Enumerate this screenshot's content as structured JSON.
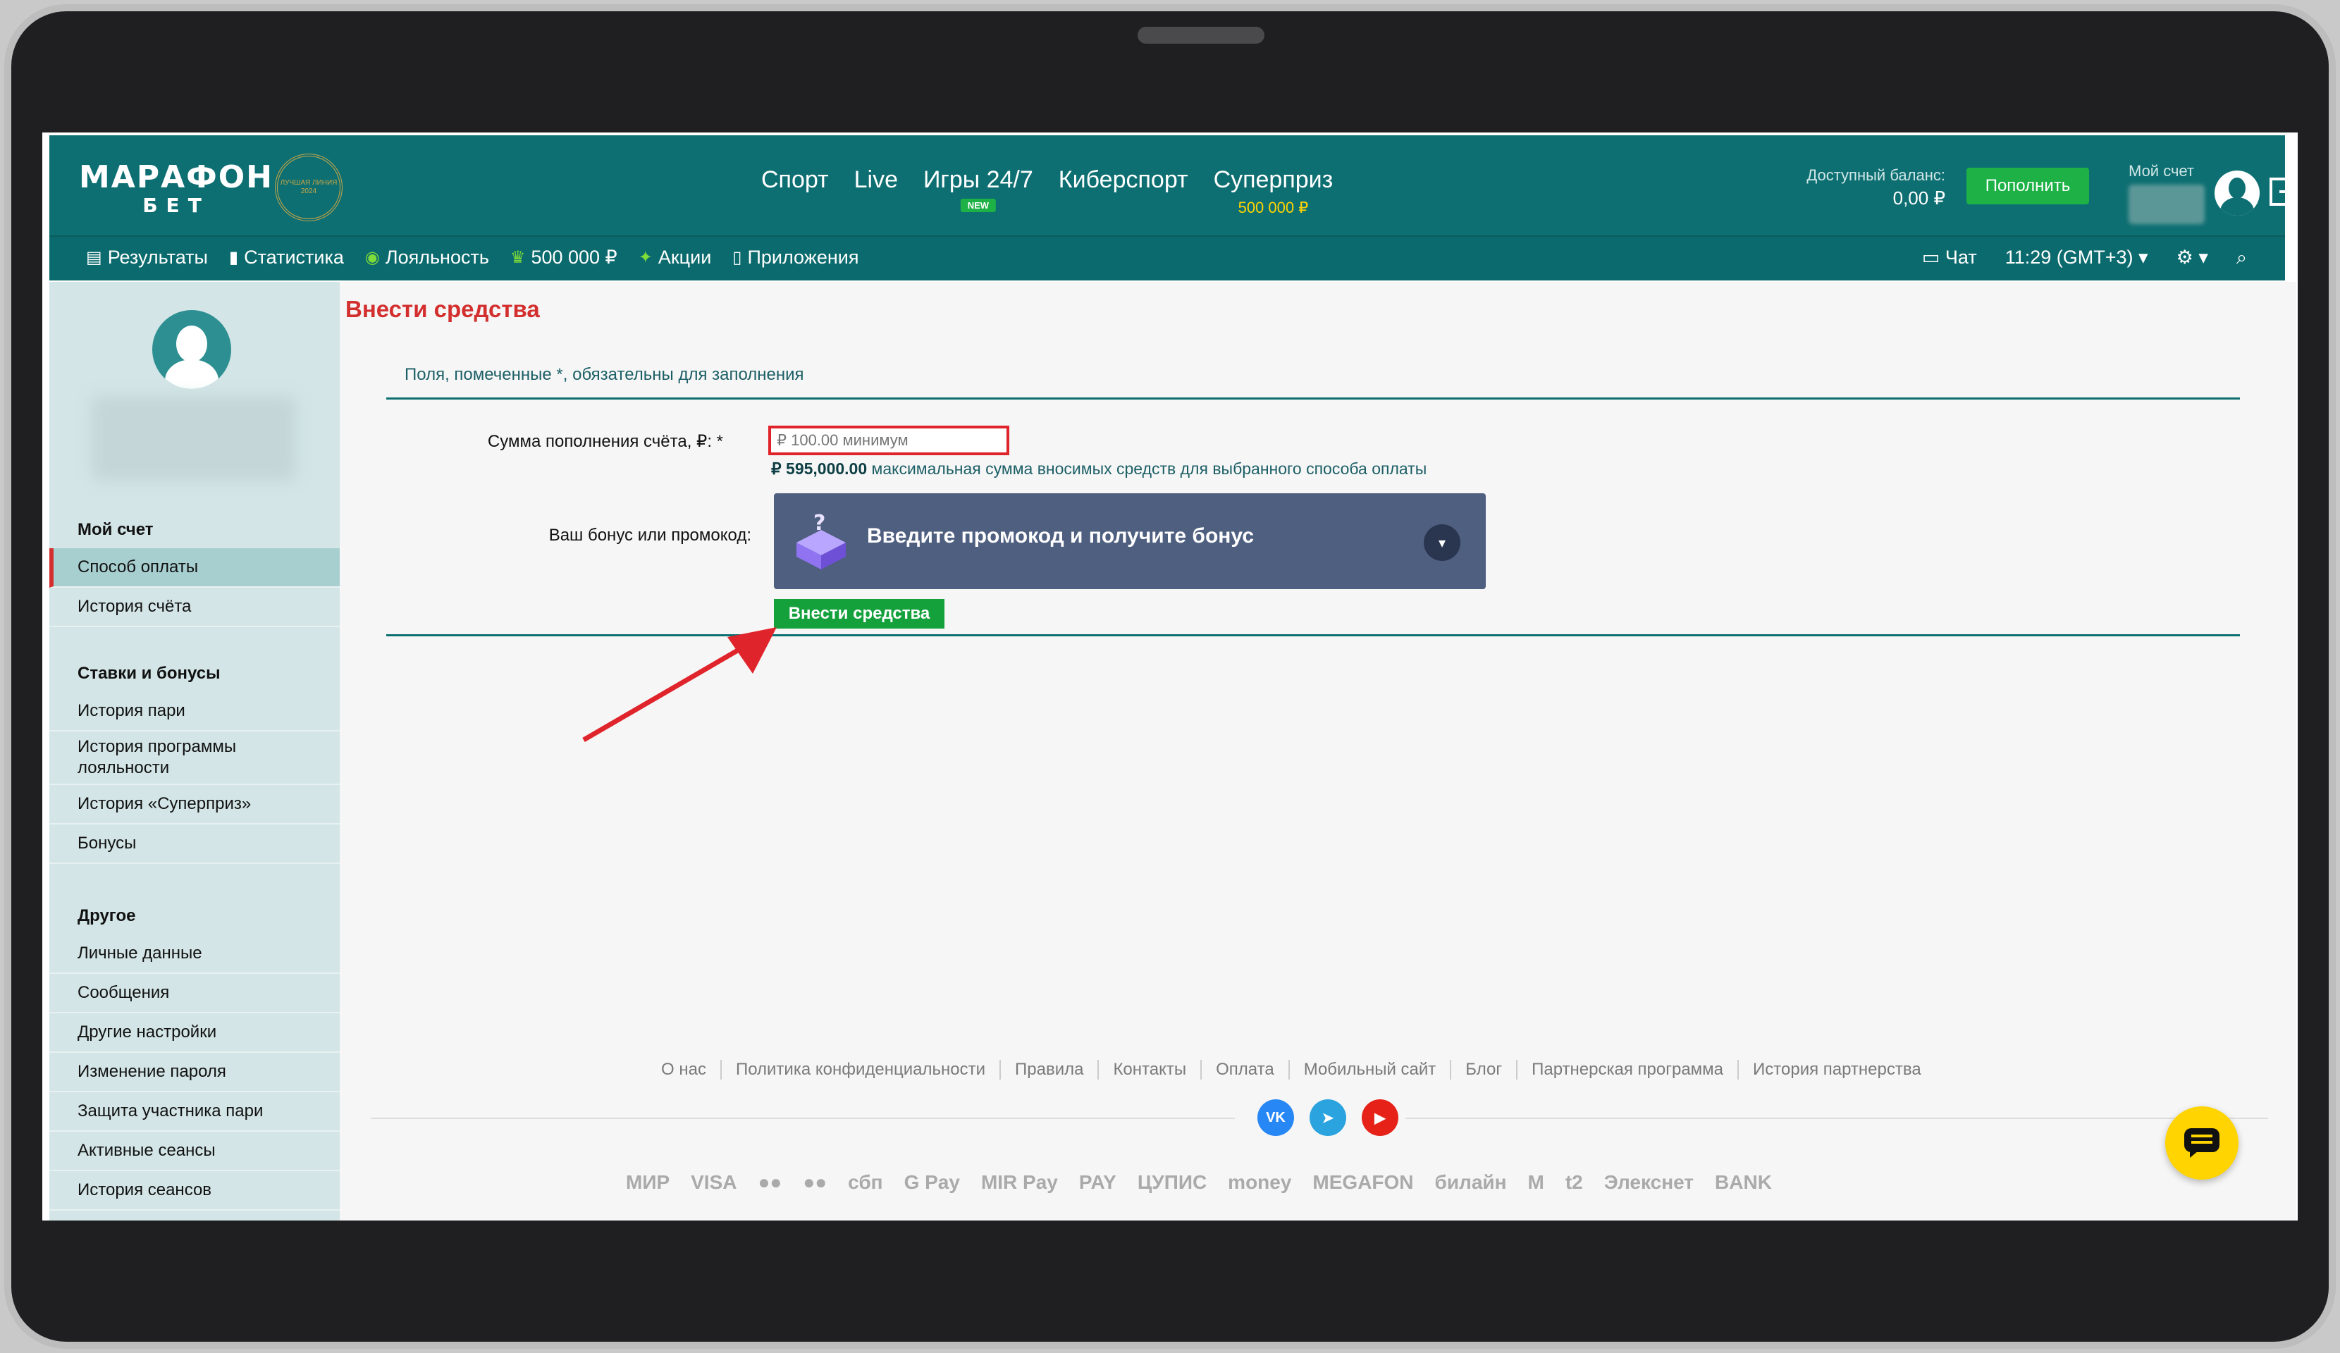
{
  "header": {
    "logo_main": "МАРАФОН",
    "logo_sub": "БЕТ",
    "badge_text": "ЛУЧШАЯ ЛИНИЯ 2024",
    "nav": [
      {
        "label": "Спорт"
      },
      {
        "label": "Live"
      },
      {
        "label": "Игры 24/7",
        "badge": "NEW"
      },
      {
        "label": "Киберспорт"
      },
      {
        "label": "Суперприз",
        "sub": "500 000 ₽"
      }
    ],
    "balance_label": "Доступный баланс:",
    "balance_value": "0,00 ₽",
    "deposit_button": "Пополнить",
    "account_label": "Мой счет"
  },
  "subbar": {
    "items": [
      {
        "label": "Результаты",
        "icon": "results-icon"
      },
      {
        "label": "Статистика",
        "icon": "stats-icon"
      },
      {
        "label": "Лояльность",
        "icon": "loyalty-icon"
      },
      {
        "label": "500 000 ₽",
        "icon": "prize-icon"
      },
      {
        "label": "Акции",
        "icon": "promo-icon"
      },
      {
        "label": "Приложения",
        "icon": "phone-icon"
      }
    ],
    "chat": "Чат",
    "time": "11:29 (GMT+3)"
  },
  "sidebar": {
    "sections": [
      {
        "title": "Мой счет",
        "items": [
          "Способ оплаты",
          "История счёта"
        ]
      },
      {
        "title": "Ставки и бонусы",
        "items": [
          "История пари",
          "История программы лояльности",
          "История «Суперприз»",
          "Бонусы"
        ]
      },
      {
        "title": "Другое",
        "items": [
          "Личные данные",
          "Сообщения",
          "Другие настройки",
          "Изменение пароля",
          "Защита участника пари",
          "Активные сеансы",
          "История сеансов"
        ]
      }
    ],
    "active_item": "Способ оплаты"
  },
  "form": {
    "title": "Внести средства",
    "required_note": "Поля, помеченные *, обязательны для заполнения",
    "amount_label": "Сумма пополнения счёта, ₽: *",
    "amount_placeholder": "₽ 100.00 минимум",
    "max_amount": "₽ 595,000.00",
    "max_note": " максимальная сумма вносимых средств для выбранного способа оплаты",
    "bonus_label": "Ваш бонус или промокод:",
    "promo_text": "Введите промокод и получите бонус",
    "submit_label": "Внести средства"
  },
  "footer": {
    "links": [
      "О нас",
      "Политика конфиденциальности",
      "Правила",
      "Контакты",
      "Оплата",
      "Мобильный сайт",
      "Блог",
      "Партнерская программа",
      "История партнерства"
    ],
    "socials": [
      {
        "name": "vk-icon",
        "label": "VK",
        "color": "#2787f5"
      },
      {
        "name": "telegram-icon",
        "label": "➤",
        "color": "#2aa3df"
      },
      {
        "name": "youtube-icon",
        "label": "▶",
        "color": "#e62117"
      }
    ],
    "payments": [
      "МИР",
      "VISA",
      "●●",
      "●●",
      "сбп",
      "G Pay",
      "MIR Pay",
      "PAY",
      "ЦУПИС",
      "money",
      "MEGAFON",
      "билайн",
      "M",
      "t2",
      "Элекснет",
      "BANK"
    ]
  },
  "colors": {
    "brand": "#0e6f72",
    "accent_red": "#d32f2f",
    "green": "#1db146",
    "promo_bg": "#4f5f80",
    "fab": "#ffd400"
  }
}
